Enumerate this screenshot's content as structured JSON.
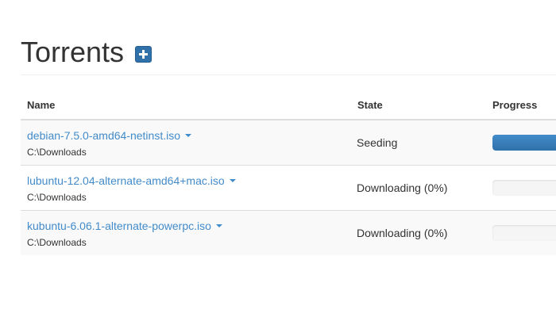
{
  "page": {
    "title": "Torrents",
    "add_icon": "plus-icon",
    "accent_color": "#428bca"
  },
  "table": {
    "headers": {
      "name": "Name",
      "state": "State",
      "progress": "Progress"
    },
    "rows": [
      {
        "name": "debian-7.5.0-amd64-netinst.iso",
        "path": "C:\\Downloads",
        "state": "Seeding",
        "progress": 1.0
      },
      {
        "name": "lubuntu-12.04-alternate-amd64+mac.iso",
        "path": "C:\\Downloads",
        "state": "Downloading (0%)",
        "progress": 0.0
      },
      {
        "name": "kubuntu-6.06.1-alternate-powerpc.iso",
        "path": "C:\\Downloads",
        "state": "Downloading (0%)",
        "progress": 0.0
      }
    ]
  }
}
